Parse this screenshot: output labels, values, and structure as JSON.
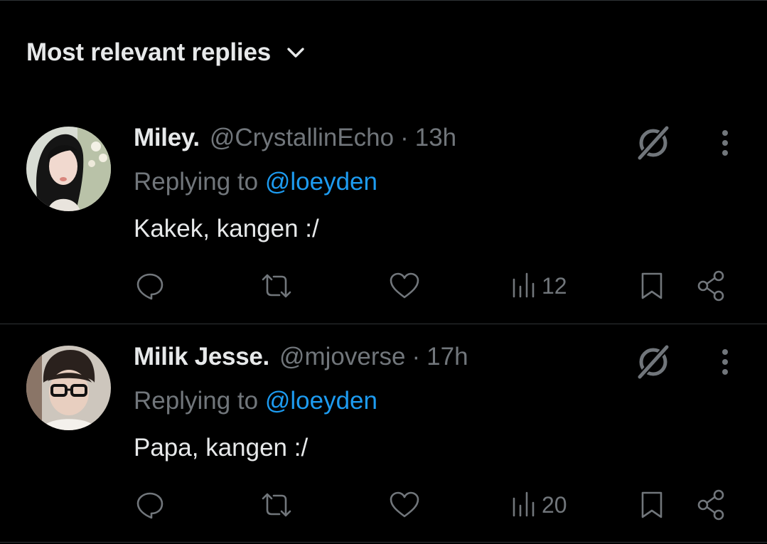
{
  "sort": {
    "label": "Most relevant replies",
    "icon": "chevron-down-icon"
  },
  "colors": {
    "background": "#000000",
    "primary_text": "#e7e9ea",
    "secondary_text": "#71767b",
    "link": "#1d9bf0",
    "divider": "#2f3336"
  },
  "replies": [
    {
      "display_name": "Miley.",
      "handle": "@CrystallinEcho",
      "separator": "·",
      "time": "13h",
      "replying_prefix": "Replying to",
      "replying_to": "@loeyden",
      "text": "Kakek, kangen :/",
      "views": "12"
    },
    {
      "display_name": "Milik Jesse.",
      "handle": "@mjoverse",
      "separator": "·",
      "time": "17h",
      "replying_prefix": "Replying to",
      "replying_to": "@loeyden",
      "text": "Papa, kangen :/",
      "views": "20"
    }
  ]
}
